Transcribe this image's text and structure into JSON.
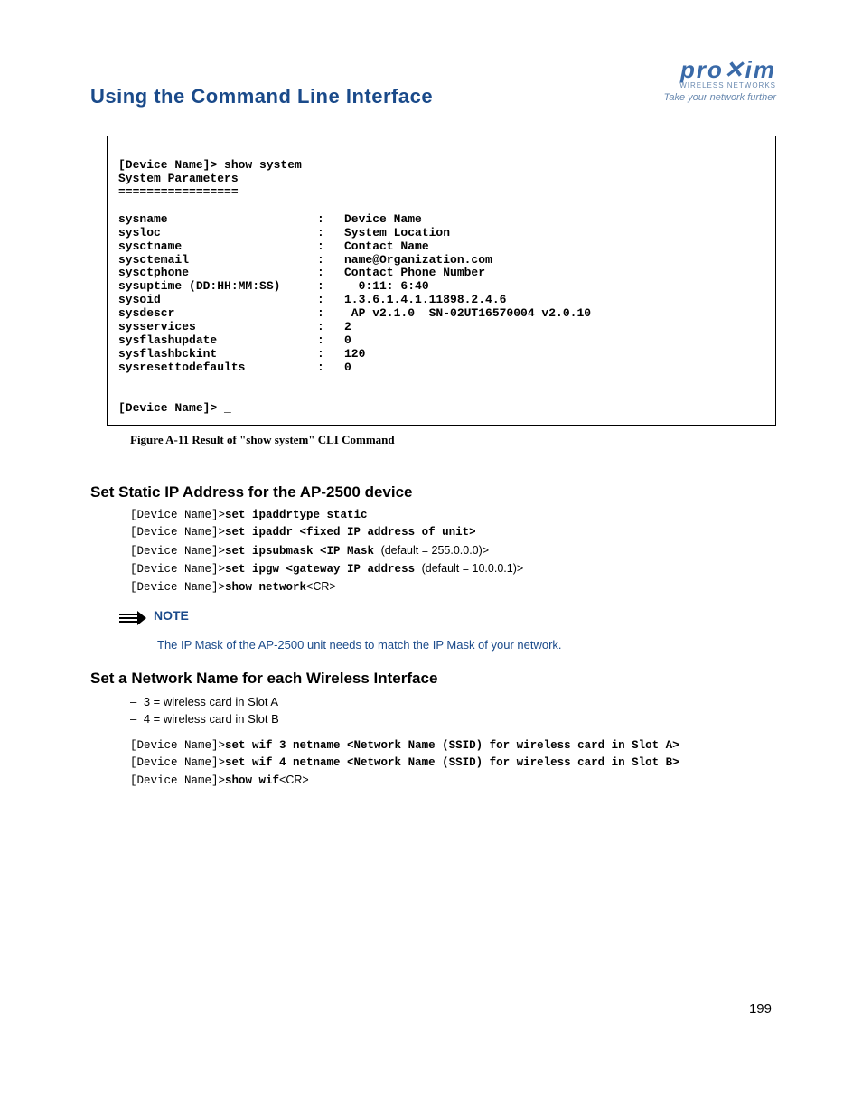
{
  "header": {
    "title": "Using the Command Line Interface",
    "logo_main": "pro",
    "logo_accent": "✕",
    "logo_main2": "im",
    "logo_sub": "WIRELESS NETWORKS",
    "logo_tag": "Take your network further"
  },
  "cli": {
    "prompt1": "[Device Name]> show system",
    "header1": "System Parameters",
    "rule": "=================",
    "rows": [
      {
        "k": "sysname",
        "v": "Device Name"
      },
      {
        "k": "sysloc",
        "v": "System Location"
      },
      {
        "k": "sysctname",
        "v": "Contact Name"
      },
      {
        "k": "sysctemail",
        "v": "name@Organization.com"
      },
      {
        "k": "sysctphone",
        "v": "Contact Phone Number"
      },
      {
        "k": "sysuptime (DD:HH:MM:SS)",
        "v": "  0:11: 6:40"
      },
      {
        "k": "sysoid",
        "v": "1.3.6.1.4.1.11898.2.4.6"
      },
      {
        "k": "sysdescr",
        "v": " AP v2.1.0  SN-02UT16570004 v2.0.10"
      },
      {
        "k": "sysservices",
        "v": "2"
      },
      {
        "k": "sysflashupdate",
        "v": "0"
      },
      {
        "k": "sysflashbckint",
        "v": "120"
      },
      {
        "k": "sysresettodefaults",
        "v": "0"
      }
    ],
    "prompt2": "[Device Name]> _"
  },
  "figure_caption": "Figure A-11   Result of \"show system\" CLI Command",
  "section1": {
    "heading": "Set Static IP Address for the AP-2500 device",
    "lines": [
      {
        "p": "[Device Name]>",
        "c": "set ipaddrtype static",
        "plain": ""
      },
      {
        "p": "[Device Name]>",
        "c": "set ipaddr <fixed IP address of unit>",
        "plain": ""
      },
      {
        "p": "[Device Name]>",
        "c": "set ipsubmask <IP Mask ",
        "plain": "(default = 255.0.0.0)>"
      },
      {
        "p": "[Device Name]>",
        "c": "set ipgw <gateway IP address ",
        "plain": "(default = 10.0.0.1)>"
      },
      {
        "p": "[Device Name]>",
        "c": "show network",
        "plain": "<CR>"
      }
    ]
  },
  "note": {
    "label": "NOTE",
    "body": "The IP Mask of the AP-2500 unit needs to match the IP Mask of your network."
  },
  "section2": {
    "heading": "Set a Network Name for each Wireless Interface",
    "bullets": [
      "3 = wireless card in Slot A",
      "4 = wireless card in Slot B"
    ],
    "lines": [
      {
        "p": "[Device Name]>",
        "c": "set wif 3 netname <Network Name (SSID) for wireless card in Slot A>",
        "plain": ""
      },
      {
        "p": "[Device Name]>",
        "c": "set wif 4 netname <Network Name (SSID) for wireless card in Slot B>",
        "plain": ""
      },
      {
        "p": "[Device Name]>",
        "c": "show wif",
        "plain": "<CR>"
      }
    ]
  },
  "page_number": "199"
}
